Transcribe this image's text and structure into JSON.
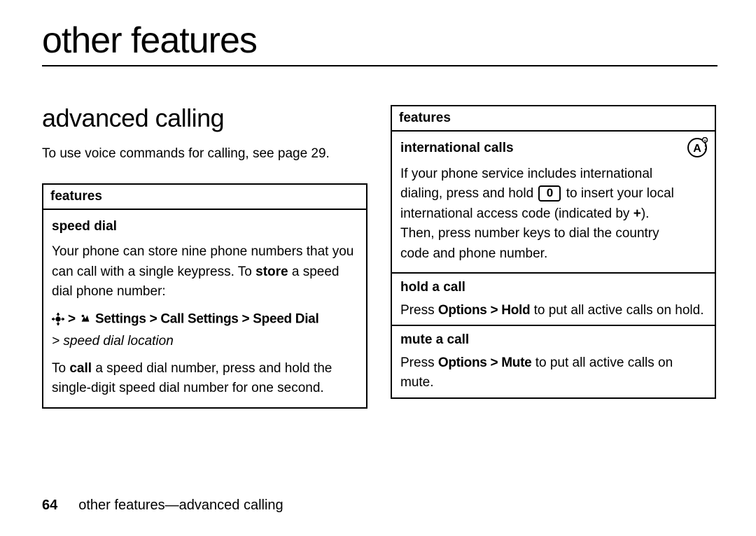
{
  "page": {
    "title": "other features",
    "section": "advanced calling",
    "intro": "To use voice commands for calling, see page 29.",
    "footer_page": "64",
    "footer_text": "other features—advanced calling"
  },
  "left_table": {
    "header": "features",
    "speed_dial": {
      "title": "speed dial",
      "p1a": "Your phone can store nine phone numbers that you can call with a single keypress. To ",
      "p1b_bold": "store",
      "p1c": " a speed dial phone number:",
      "nav_gt1": " > ",
      "nav_path": "Settings > Call Settings > Speed Dial",
      "nav_sub": "> speed dial location",
      "p2a": "To ",
      "p2b_bold": "call",
      "p2c": " a speed dial number, press and hold the single-digit speed dial number for one second."
    }
  },
  "right_table": {
    "header": "features",
    "intl": {
      "title": "international calls",
      "p1a": "If your phone service includes international dialing, press and hold ",
      "key": "0",
      "p1b": " to insert your local international access code (indicated by ",
      "plus": "+",
      "p1c": "). Then, press number keys to dial the country code and phone number."
    },
    "hold": {
      "title": "hold a call",
      "pa": "Press ",
      "pb_bold": "Options > Hold",
      "pc": " to put all active calls on hold."
    },
    "mute": {
      "title": "mute a call",
      "pa": "Press ",
      "pb_bold": "Options > Mute",
      "pc": " to put all active calls on mute."
    }
  }
}
